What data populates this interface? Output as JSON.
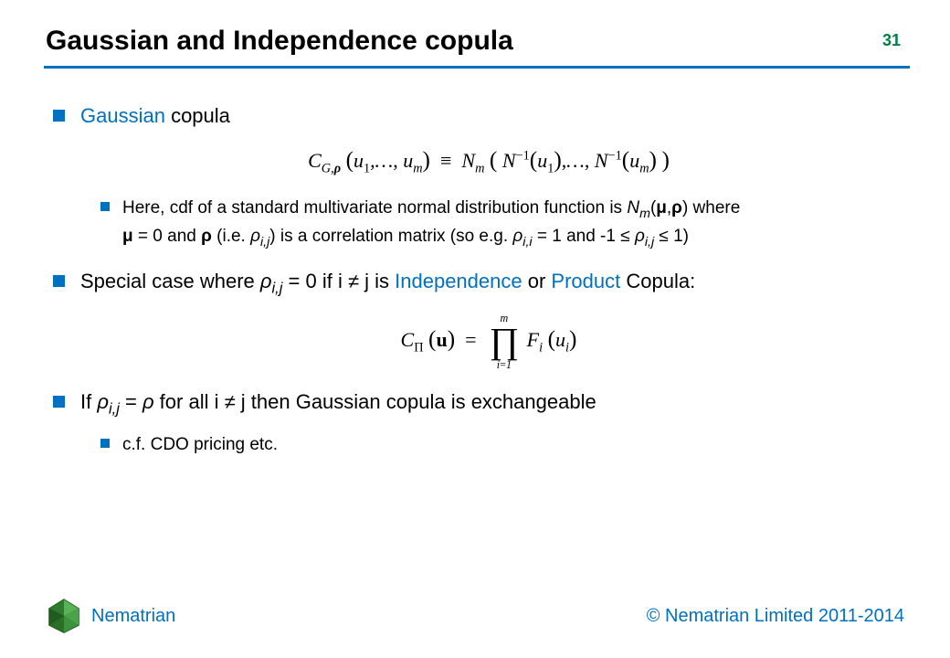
{
  "page_number": "31",
  "title": "Gaussian and Independence copula",
  "bullets": {
    "b1_blue": "Gaussian",
    "b1_rest": " copula",
    "formula1": "C_{G,ρ}(u₁,…,u_m) ≡ N_m(N⁻¹(u₁),…,N⁻¹(u_m))",
    "b1_sub_intro": "Here, cdf of a standard multivariate normal distribution function is ",
    "b1_sub_Nm": "N",
    "b1_sub_m": "m",
    "b1_sub_paren_open": "(",
    "b1_sub_mu": "μ",
    "b1_sub_comma": ",",
    "b1_sub_rho": "ρ",
    "b1_sub_paren_close": ") where",
    "b1_sub2_mu": "μ",
    "b1_sub2_eq0": " = 0 and ",
    "b1_sub2_rho": "ρ",
    "b1_sub2_rest": " (i.e. ",
    "b1_sub2_rhoij": "ρ",
    "b1_sub2_ij": "i,j",
    "b1_sub2_rest2": ") is a correlation matrix (so e.g. ",
    "b1_sub2_rhoii": "ρ",
    "b1_sub2_ii": "i,i",
    "b1_sub2_eq1": " = 1 and -1 ≤ ",
    "b1_sub2_rhoij2": "ρ",
    "b1_sub2_ij2": "i,j",
    "b1_sub2_le1": " ≤ 1)",
    "b2_pre": "Special case where ",
    "b2_rho": "ρ",
    "b2_ij": "i,j",
    "b2_mid": " = 0 if i ≠ j is ",
    "b2_ind": "Independence",
    "b2_or": " or ",
    "b2_prod": "Product",
    "b2_post": " Copula:",
    "formula2": "C_Π(u) = ∏_{i=1}^{m} F_i(u_i)",
    "b3_pre": "If ",
    "b3_rho": "ρ",
    "b3_ij": "i,j",
    "b3_mid": " = ",
    "b3_rho2": "ρ",
    "b3_rest": " for all i ≠ j then Gaussian copula is exchangeable",
    "b3_sub": "c.f. CDO pricing etc."
  },
  "footer": {
    "company": "Nematrian",
    "copyright": "© Nematrian Limited 2011-2014"
  }
}
